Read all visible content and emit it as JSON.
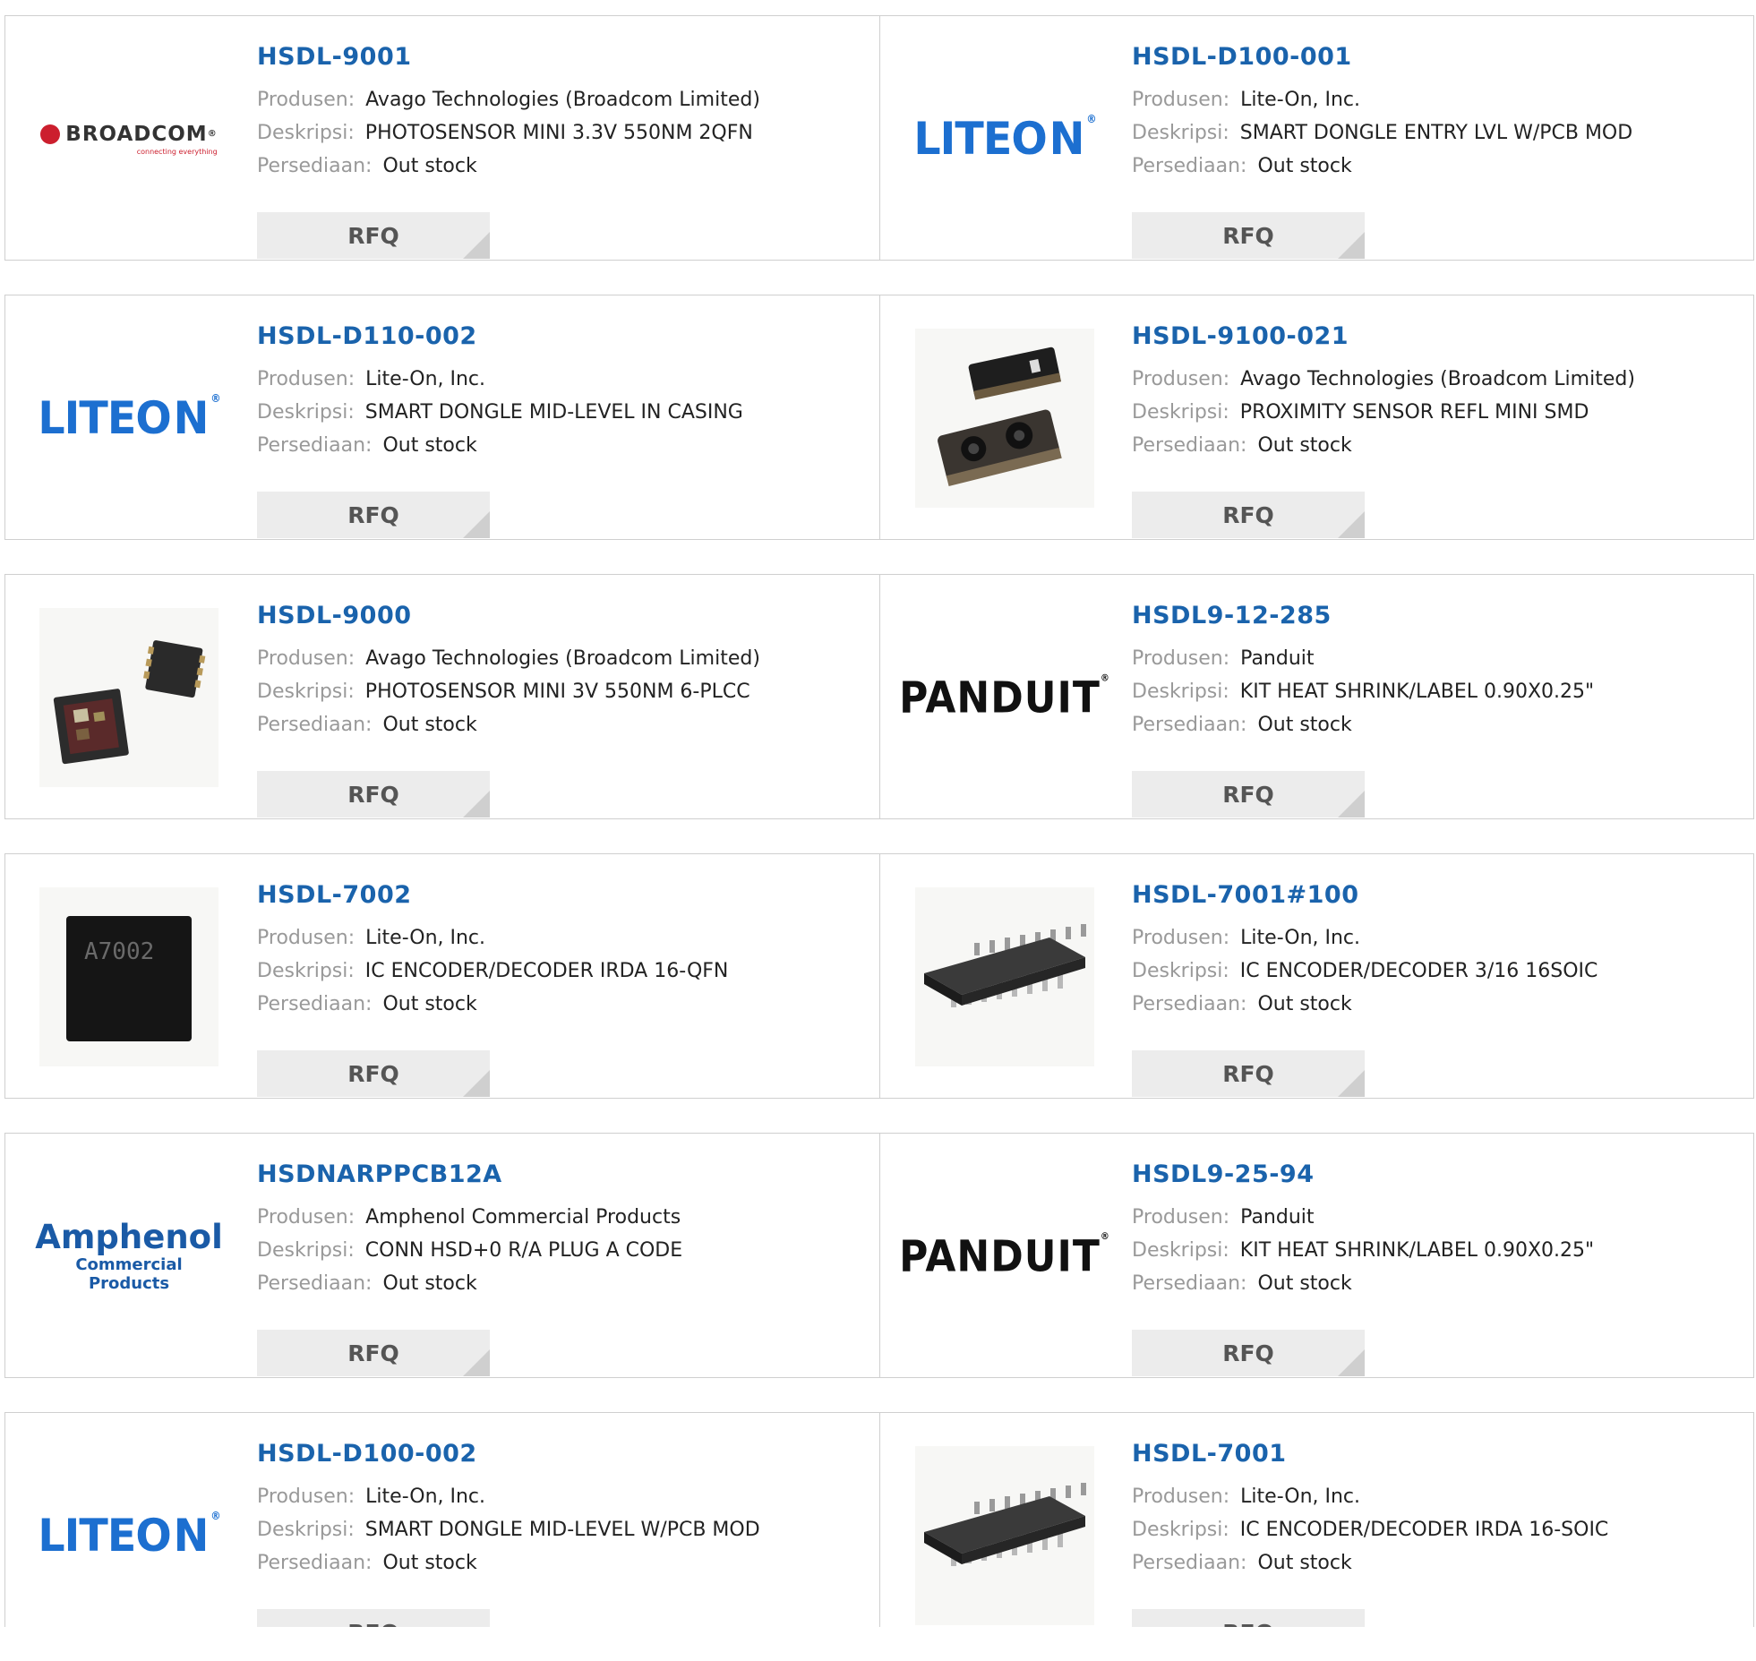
{
  "labels": {
    "manufacturer": "Produsen:",
    "description": "Deskripsi:",
    "stock": "Persediaan:",
    "rfq": "RFQ"
  },
  "colors": {
    "part_link": "#1a63ac",
    "label_gray": "#999999",
    "rfq_bg": "#ececec"
  },
  "rows": [
    [
      {
        "part": "HSDL-9001",
        "manufacturer": "Avago Technologies (Broadcom Limited)",
        "description": "PHOTOSENSOR MINI 3.3V 550NM 2QFN",
        "stock": "Out stock",
        "image": "broadcom-logo"
      },
      {
        "part": "HSDL-D100-001",
        "manufacturer": "Lite-On, Inc.",
        "description": "SMART DONGLE ENTRY LVL W/PCB MOD",
        "stock": "Out stock",
        "image": "liteon-logo"
      }
    ],
    [
      {
        "part": "HSDL-D110-002",
        "manufacturer": "Lite-On, Inc.",
        "description": "SMART DONGLE MID-LEVEL IN CASING",
        "stock": "Out stock",
        "image": "liteon-logo"
      },
      {
        "part": "HSDL-9100-021",
        "manufacturer": "Avago Technologies (Broadcom Limited)",
        "description": "PROXIMITY SENSOR REFL MINI SMD",
        "stock": "Out stock",
        "image": "proximity-sensor-photo"
      }
    ],
    [
      {
        "part": "HSDL-9000",
        "manufacturer": "Avago Technologies (Broadcom Limited)",
        "description": "PHOTOSENSOR MINI 3V 550NM 6-PLCC",
        "stock": "Out stock",
        "image": "photosensor-chip-photo"
      },
      {
        "part": "HSDL9-12-285",
        "manufacturer": "Panduit",
        "description": "KIT HEAT SHRINK/LABEL 0.90X0.25\"",
        "stock": "Out stock",
        "image": "panduit-logo"
      }
    ],
    [
      {
        "part": "HSDL-7002",
        "manufacturer": "Lite-On, Inc.",
        "description": "IC ENCODER/DECODER IRDA 16-QFN",
        "stock": "Out stock",
        "image": "qfn-chip-photo",
        "chip_text": "A7002"
      },
      {
        "part": "HSDL-7001#100",
        "manufacturer": "Lite-On, Inc.",
        "description": "IC ENCODER/DECODER 3/16 16SOIC",
        "stock": "Out stock",
        "image": "soic-chip-photo"
      }
    ],
    [
      {
        "part": "HSDNARPPCB12A",
        "manufacturer": "Amphenol Commercial Products",
        "description": "CONN HSD+0 R/A PLUG A CODE",
        "stock": "Out stock",
        "image": "amphenol-logo"
      },
      {
        "part": "HSDL9-25-94",
        "manufacturer": "Panduit",
        "description": "KIT HEAT SHRINK/LABEL 0.90X0.25\"",
        "stock": "Out stock",
        "image": "panduit-logo"
      }
    ],
    [
      {
        "part": "HSDL-D100-002",
        "manufacturer": "Lite-On, Inc.",
        "description": "SMART DONGLE MID-LEVEL W/PCB MOD",
        "stock": "Out stock",
        "image": "liteon-logo"
      },
      {
        "part": "HSDL-7001",
        "manufacturer": "Lite-On, Inc.",
        "description": "IC ENCODER/DECODER IRDA 16-SOIC",
        "stock": "Out stock",
        "image": "soic-chip-photo"
      }
    ]
  ]
}
